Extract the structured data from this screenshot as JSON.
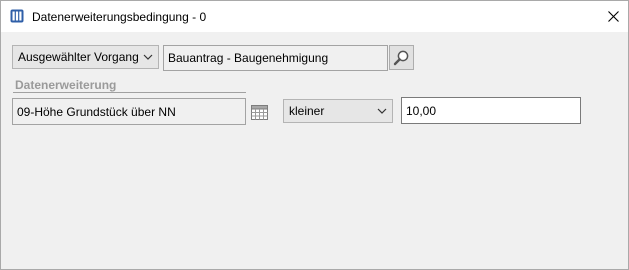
{
  "window": {
    "title": "Datenerweiterungsbedingung - 0",
    "app_icon": "columns-icon",
    "close_icon": "close-icon"
  },
  "scope_dropdown": {
    "value": "Ausgewählter Vorgang",
    "icon": "chevron-down-icon"
  },
  "process_field": {
    "value": "Bauantrag - Baugenehmigung"
  },
  "search_button": {
    "icon": "magnifier-icon"
  },
  "section": {
    "label": "Datenerweiterung"
  },
  "extension_field": {
    "value": "09-Höhe Grundstück über NN"
  },
  "table_button": {
    "icon": "table-icon"
  },
  "operator_dropdown": {
    "value": "kleiner",
    "icon": "chevron-down-icon"
  },
  "value_input": {
    "value": "10,00"
  }
}
